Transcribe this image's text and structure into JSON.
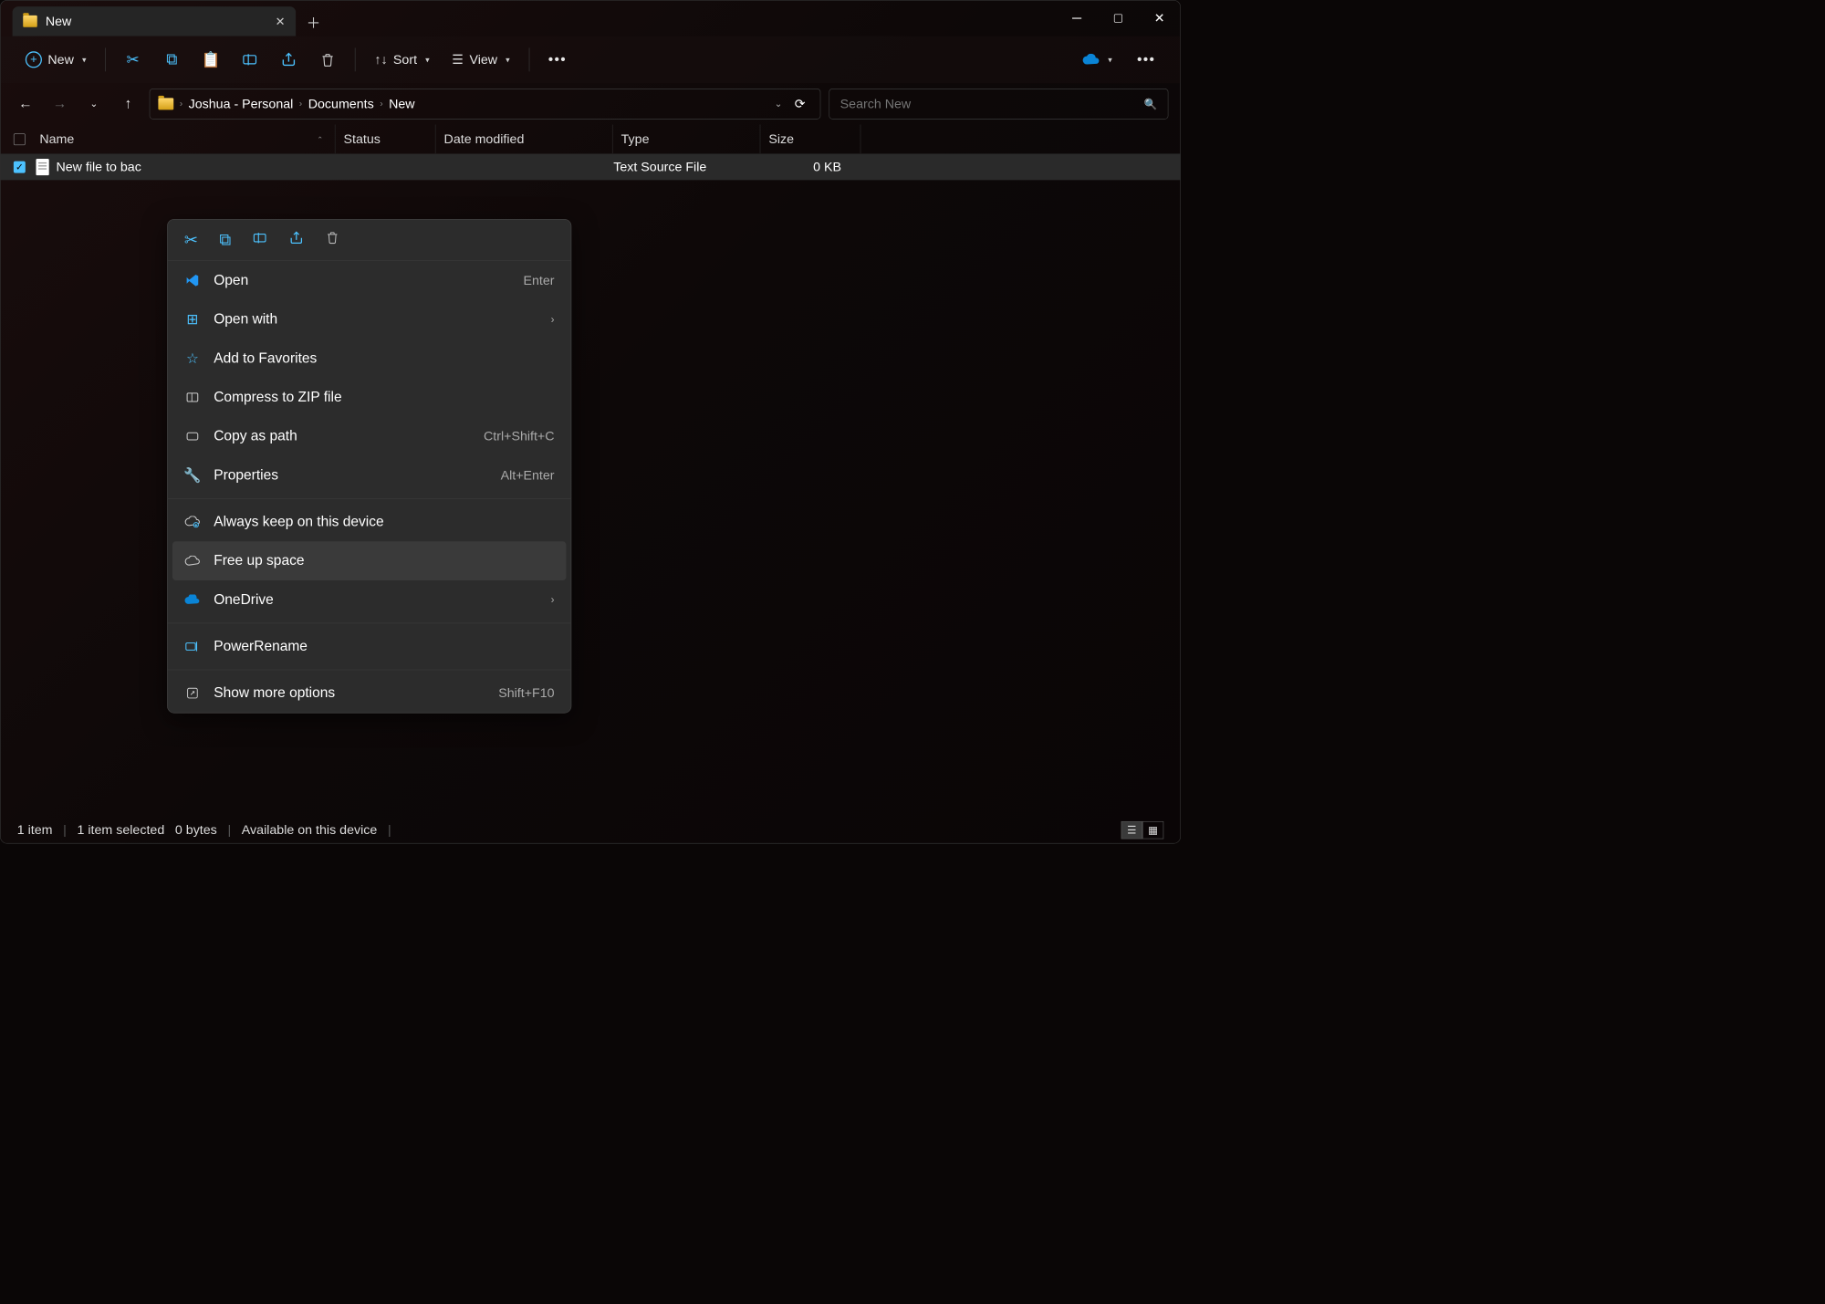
{
  "tab": {
    "title": "New"
  },
  "toolbar": {
    "new": "New",
    "sort": "Sort",
    "view": "View"
  },
  "breadcrumbs": [
    "Joshua - Personal",
    "Documents",
    "New"
  ],
  "search": {
    "placeholder": "Search New"
  },
  "headers": {
    "name": "Name",
    "status": "Status",
    "date": "Date modified",
    "type": "Type",
    "size": "Size"
  },
  "file": {
    "name": "New file to bac",
    "type": "Text Source File",
    "size": "0 KB"
  },
  "ctx": {
    "open": "Open",
    "open_sc": "Enter",
    "open_with": "Open with",
    "fav": "Add to Favorites",
    "zip": "Compress to ZIP file",
    "copy_path": "Copy as path",
    "copy_path_sc": "Ctrl+Shift+C",
    "props": "Properties",
    "props_sc": "Alt+Enter",
    "always": "Always keep on this device",
    "free": "Free up space",
    "onedrive": "OneDrive",
    "rename": "PowerRename",
    "more": "Show more options",
    "more_sc": "Shift+F10"
  },
  "status": {
    "items": "1 item",
    "selected": "1 item selected",
    "bytes": "0 bytes",
    "avail": "Available on this device"
  }
}
